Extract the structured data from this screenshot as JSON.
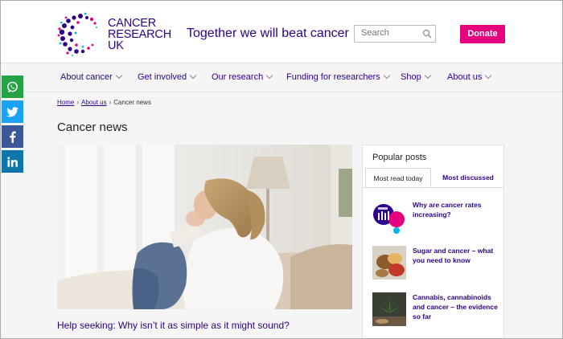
{
  "brand": {
    "logo_lines": [
      "CANCER",
      "RESEARCH",
      "UK"
    ],
    "tagline": "Together we will beat cancer",
    "accent_color": "#2e008b",
    "donate_color": "#e5007e"
  },
  "search": {
    "placeholder": "Search"
  },
  "donate_label": "Donate",
  "nav": [
    {
      "label": "About cancer"
    },
    {
      "label": "Get involved"
    },
    {
      "label": "Our research"
    },
    {
      "label": "Funding for researchers"
    },
    {
      "label": "Shop"
    },
    {
      "label": "About us"
    }
  ],
  "share": [
    {
      "icon": "whatsapp-icon",
      "color": "#25a244"
    },
    {
      "icon": "twitter-icon",
      "color": "#1da1f2"
    },
    {
      "icon": "facebook-icon",
      "color": "#3b5998"
    },
    {
      "icon": "linkedin-icon",
      "color": "#0e76a8"
    }
  ],
  "breadcrumb": {
    "home": "Home",
    "about": "About us",
    "current": "Cancer news",
    "separator": "›"
  },
  "page_title": "Cancer news",
  "featured": {
    "title": "Help seeking: Why isn’t it as simple as it might sound?"
  },
  "popular": {
    "title": "Popular posts",
    "tabs": [
      {
        "label": "Most read today"
      },
      {
        "label": "Most discussed"
      }
    ],
    "posts": [
      {
        "title": "Why are cancer rates increasing?"
      },
      {
        "title": "Sugar and cancer – what you need to know"
      },
      {
        "title": "Cannabis, cannabinoids and cancer – the evidence so far"
      }
    ]
  }
}
